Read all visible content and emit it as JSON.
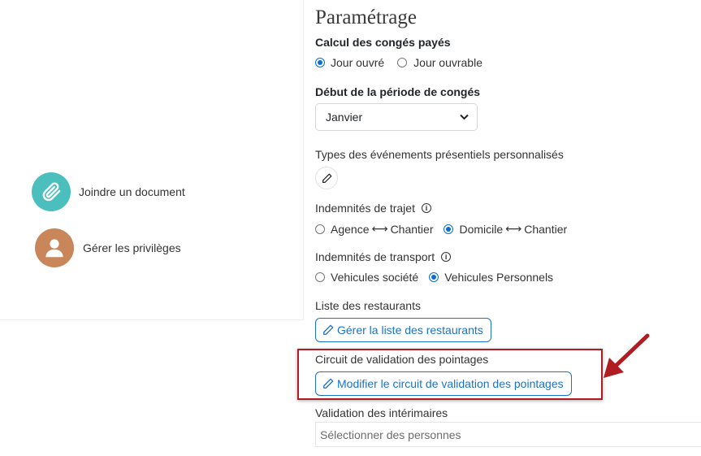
{
  "left_panel": {
    "attach_label": "Joindre un document",
    "privileges_label": "Gérer les privilèges",
    "attach_color": "#4bbfbe",
    "avatar_color": "#c8865a"
  },
  "settings": {
    "title": "Paramétrage",
    "paid_leave": {
      "label": "Calcul des congés payés",
      "options": [
        "Jour ouvré",
        "Jour ouvrable"
      ],
      "selected": "Jour ouvré"
    },
    "period_start": {
      "label": "Début de la période de congés",
      "value": "Janvier"
    },
    "event_types": {
      "label": "Types des événements présentiels personnalisés"
    },
    "travel_allowance": {
      "label": "Indemnités de trajet",
      "option1_a": "Agence",
      "option1_b": "Chantier",
      "option2_a": "Domicile",
      "option2_b": "Chantier",
      "selected": "Domicile ↔ Chantier"
    },
    "transport_allowance": {
      "label": "Indemnités de transport",
      "options": [
        "Vehicules société",
        "Vehicules Personnels"
      ],
      "selected": "Vehicules Personnels"
    },
    "restaurants": {
      "label": "Liste des restaurants",
      "button": "Gérer la liste des restaurants"
    },
    "validation_circuit": {
      "label": "Circuit de validation des pointages",
      "button": "Modifier le circuit de validation des pointages"
    },
    "temp_workers": {
      "label": "Validation des intérimaires",
      "placeholder": "Sélectionner des personnes"
    }
  },
  "colors": {
    "accent": "#1a73c9",
    "highlight": "#b01c21"
  }
}
